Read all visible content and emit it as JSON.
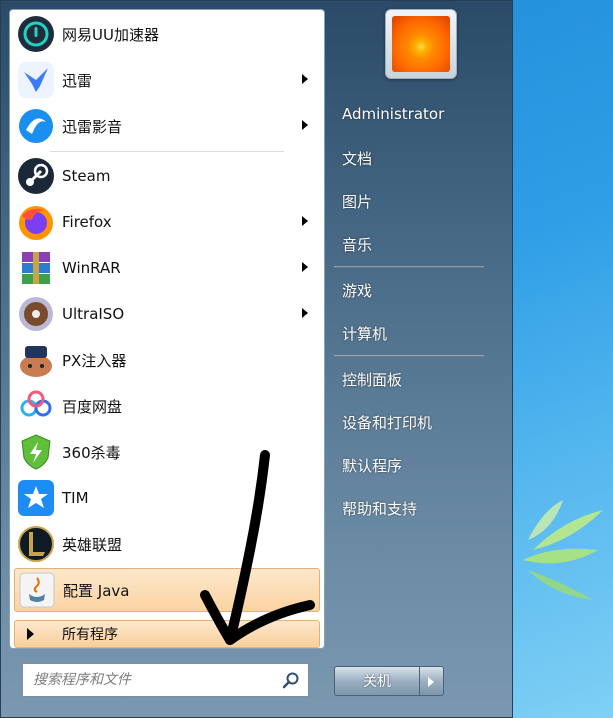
{
  "programs": [
    {
      "label": "网易UU加速器",
      "has_submenu": false,
      "icon": "uu-accelerator-icon"
    },
    {
      "label": "迅雷",
      "has_submenu": true,
      "icon": "xunlei-icon"
    },
    {
      "label": "迅雷影音",
      "has_submenu": true,
      "icon": "xunlei-player-icon"
    },
    {
      "label": "Steam",
      "has_submenu": false,
      "icon": "steam-icon"
    },
    {
      "label": "Firefox",
      "has_submenu": true,
      "icon": "firefox-icon"
    },
    {
      "label": "WinRAR",
      "has_submenu": true,
      "icon": "winrar-icon"
    },
    {
      "label": "UltraISO",
      "has_submenu": true,
      "icon": "ultraiso-icon"
    },
    {
      "label": "PX注入器",
      "has_submenu": false,
      "icon": "px-injector-icon"
    },
    {
      "label": "百度网盘",
      "has_submenu": false,
      "icon": "baidu-netdisk-icon"
    },
    {
      "label": "360杀毒",
      "has_submenu": false,
      "icon": "360-antivirus-icon"
    },
    {
      "label": "TIM",
      "has_submenu": false,
      "icon": "tim-icon"
    },
    {
      "label": "英雄联盟",
      "has_submenu": false,
      "icon": "league-of-legends-icon"
    },
    {
      "label": "配置 Java",
      "has_submenu": false,
      "icon": "java-icon",
      "highlighted": true
    }
  ],
  "all_programs": {
    "label": "所有程序"
  },
  "search": {
    "placeholder": "搜索程序和文件"
  },
  "right_menu": {
    "user": "Administrator",
    "items": [
      "文档",
      "图片",
      "音乐",
      "游戏",
      "计算机",
      "控制面板",
      "设备和打印机",
      "默认程序",
      "帮助和支持"
    ]
  },
  "shutdown": {
    "label": "关机"
  },
  "colors": {
    "highlight": "#fbd3a2",
    "menu_bg": "#496a86",
    "desktop": "#2f9ee6"
  }
}
